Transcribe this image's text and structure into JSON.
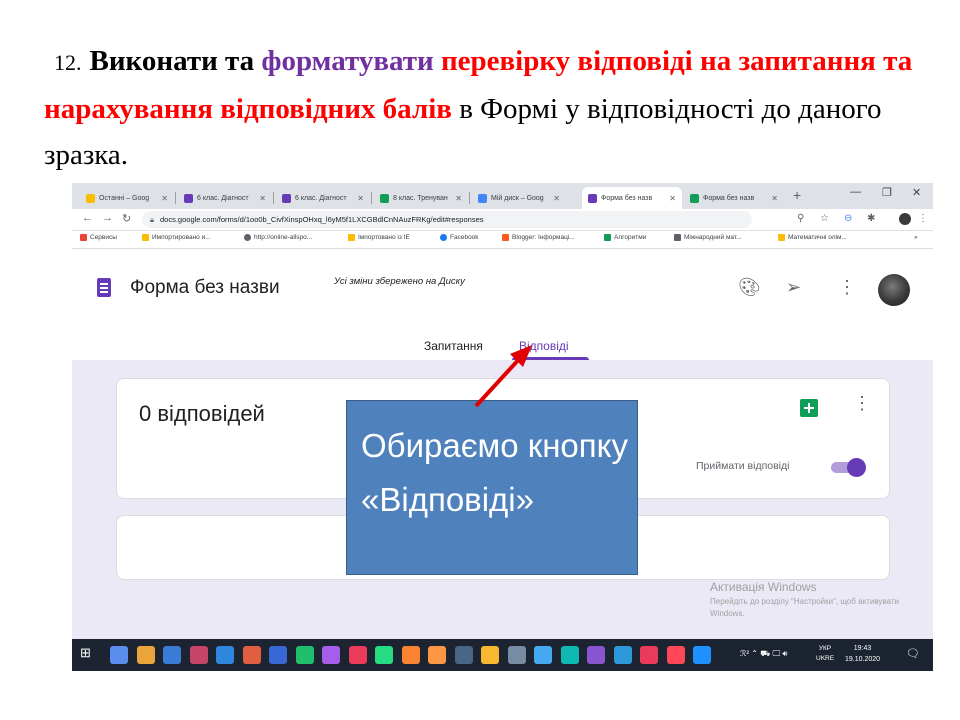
{
  "slide": {
    "number": "12.",
    "title_parts": [
      {
        "text": "Виконати та ",
        "style": "black"
      },
      {
        "text": "форматувати ",
        "style": "purple"
      },
      {
        "text": "перевірку відповіді на запитання  та нарахування відповідних балів",
        "style": "red"
      },
      {
        "text": " в ",
        "style": "black"
      },
      {
        "text": "Формі у відповідності до даного зразка.",
        "style": "norm"
      }
    ],
    "colors": {
      "purple": "#7030a0",
      "red": "#ff0000"
    }
  },
  "browser": {
    "tabs": [
      {
        "label": "Останні – Goog",
        "color": "#fbbc04",
        "active": false
      },
      {
        "label": "6 клас. Діагност",
        "color": "#673ab7",
        "active": false
      },
      {
        "label": "6 клас. Діагност",
        "color": "#673ab7",
        "active": false
      },
      {
        "label": "8 клас. Тренуван",
        "color": "#0f9d58",
        "active": false
      },
      {
        "label": "Мій диск – Goog",
        "color": "#4285f4",
        "active": false
      },
      {
        "label": "Форма без назв",
        "color": "#673ab7",
        "active": true
      },
      {
        "label": "Форма без назв",
        "color": "#0f9d58",
        "active": false
      }
    ],
    "url": "docs.google.com/forms/d/1oo0b_CivfXinspOHxq_l6yM5f1LXCGBdlCnNAuzFRKg/edit#responses",
    "bookmarks": [
      {
        "label": "Сервисы",
        "color": "#ea4335"
      },
      {
        "label": "Импортировано и...",
        "color": "#fbbc04"
      },
      {
        "label": "http://online-allspo...",
        "color": "#5f6368"
      },
      {
        "label": "Імпортовано із IE",
        "color": "#fbbc04"
      },
      {
        "label": "Facebook",
        "color": "#1877f2"
      },
      {
        "label": "Blogger: Інформаці...",
        "color": "#ff5722"
      },
      {
        "label": "Алгоритми",
        "color": "#0f9d58"
      },
      {
        "label": "Міжнародний мат...",
        "color": "#5f6368"
      },
      {
        "label": "Математичні олім...",
        "color": "#fbbc04"
      }
    ],
    "more_bookmarks": "»"
  },
  "form": {
    "title": "Форма без назви",
    "saved_status": "Усі зміни збережено на Диску",
    "tabs": {
      "questions": "Запитання",
      "responses": "Відповіді"
    },
    "response_count": "0 відповідей",
    "accept_label": "Приймати відповіді",
    "accepting": true,
    "accent": "#673ab7"
  },
  "callout": {
    "text": "Обираємо кнопку «Відповіді»",
    "color": "#4f81bd"
  },
  "watermark": {
    "title": "Активація Windows",
    "subtitle": "Перейдіть до розділу \"Настройки\", щоб активувати Windows."
  },
  "taskbar": {
    "lang": "УКР",
    "lang_sub": "UKRE",
    "time": "19:43",
    "date": "19.10.2020",
    "icon_colors": [
      "#5b8def",
      "#e9a53b",
      "#3a7bd5",
      "#c44569",
      "#2e86de",
      "#e15f41",
      "#3867d6",
      "#20bf6b",
      "#a55eea",
      "#eb3b5a",
      "#26de81",
      "#fa8231",
      "#fd9644",
      "#4b6584",
      "#f7b731",
      "#778ca3",
      "#45aaf2",
      "#0fb9b1",
      "#8854d0",
      "#2d98da",
      "#eb3b5a",
      "#ff4757",
      "#1e90ff"
    ]
  }
}
